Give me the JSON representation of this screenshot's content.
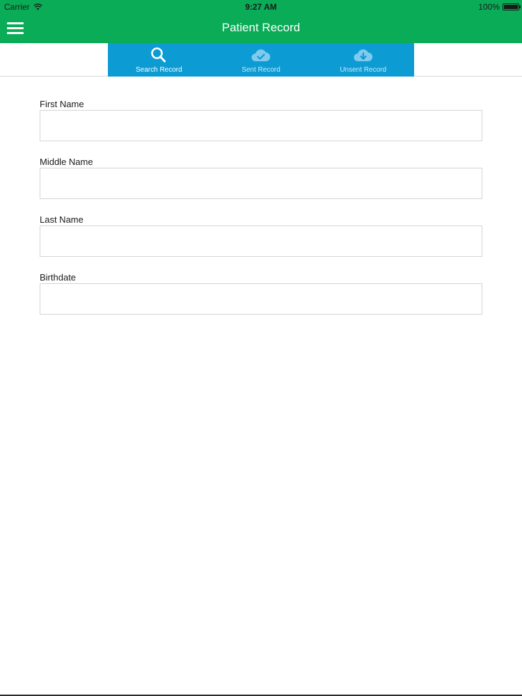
{
  "status_bar": {
    "carrier": "Carrier",
    "time": "9:27 AM",
    "battery": "100%"
  },
  "nav": {
    "title": "Patient Record",
    "menu_icon": "hamburger-menu-icon"
  },
  "tabs": [
    {
      "label": "Search Record",
      "icon": "search-icon"
    },
    {
      "label": "Sent Record",
      "icon": "cloud-check-icon"
    },
    {
      "label": "Unsent Record",
      "icon": "cloud-download-icon"
    }
  ],
  "form": {
    "fields": [
      {
        "label": "First Name",
        "value": "",
        "placeholder": ""
      },
      {
        "label": "Middle Name",
        "value": "",
        "placeholder": ""
      },
      {
        "label": "Last Name",
        "value": "",
        "placeholder": ""
      },
      {
        "label": "Birthdate",
        "value": "",
        "placeholder": ""
      }
    ]
  },
  "colors": {
    "nav_green": "#0aac57",
    "tab_blue": "#0d9bd3",
    "cloud_light_blue": "#7fcaee"
  }
}
